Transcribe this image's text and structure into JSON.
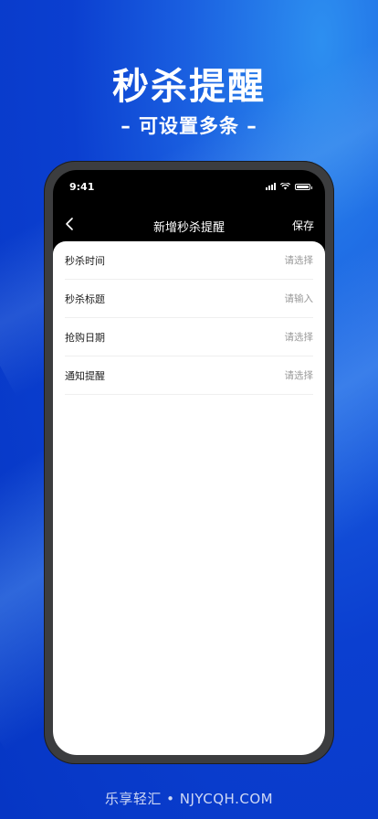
{
  "hero": {
    "title": "秒杀提醒",
    "subtitle": "– 可设置多条 –"
  },
  "status_bar": {
    "time": "9:41",
    "icons": [
      "signal-icon",
      "wifi-icon",
      "battery-icon"
    ]
  },
  "nav": {
    "back_icon": "chevron-left-icon",
    "title": "新增秒杀提醒",
    "save_label": "保存"
  },
  "form": {
    "rows": [
      {
        "label": "秒杀时间",
        "value": "请选择"
      },
      {
        "label": "秒杀标题",
        "value": "请输入"
      },
      {
        "label": "抢购日期",
        "value": "请选择"
      },
      {
        "label": "通知提醒",
        "value": "请选择"
      }
    ]
  },
  "footer": {
    "watermark": "乐享轻汇 • NJYCQH.COM"
  },
  "colors": {
    "background": "#0b3fd0",
    "phone_frame": "#3c3d3f",
    "card": "#ffffff",
    "placeholder_text": "#9a9a9a"
  }
}
